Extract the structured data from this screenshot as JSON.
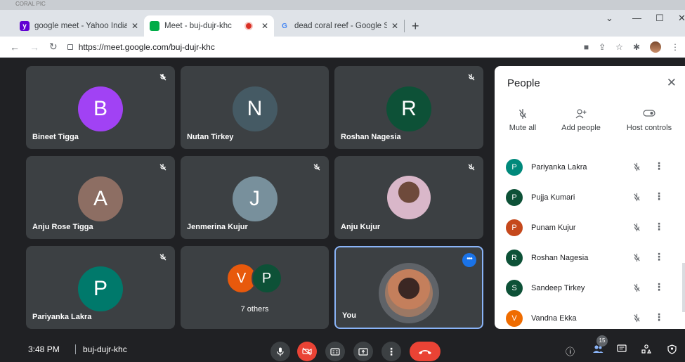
{
  "browser": {
    "top_label": "CORAL PIC",
    "tabs": [
      {
        "title": "google meet - Yahoo India Searc",
        "favicon": "yahoo-icon",
        "color": "#6001d2"
      },
      {
        "title": "Meet - buj-dujr-khc",
        "favicon": "meet-icon",
        "color": "#00ac47"
      },
      {
        "title": "dead coral reef - Google Search",
        "favicon": "google-icon",
        "color": "#4285f4"
      }
    ],
    "close_glyph": "✕",
    "new_tab": "+",
    "url": "https://meet.google.com/buj-dujr-khc"
  },
  "tiles": [
    {
      "name": "Bineet Tigga",
      "initial": "B",
      "color": "#a142f4"
    },
    {
      "name": "Nutan Tirkey",
      "initial": "N",
      "color": "#455a64"
    },
    {
      "name": "Roshan Nagesia",
      "initial": "R",
      "color": "#0d5137"
    },
    {
      "name": "Anju Rose Tigga",
      "initial": "A",
      "color": "#8d6e63"
    },
    {
      "name": "Jenmerina Kujur",
      "initial": "J",
      "color": "#78909c"
    },
    {
      "name": "Anju Kujur",
      "initial": "",
      "color": "#5f6368"
    },
    {
      "name": "Pariyanka Lakra",
      "initial": "P",
      "color": "#00796b"
    },
    {
      "name": "",
      "initial": "",
      "color": "#3c4043"
    },
    {
      "name": "You",
      "initial": "",
      "color": "#3c4043"
    }
  ],
  "others": {
    "label": "7 others",
    "avatars": [
      {
        "initial": "V",
        "color": "#e8590c"
      },
      {
        "initial": "P",
        "color": "#0d5137"
      }
    ]
  },
  "people_panel": {
    "title": "People",
    "actions": [
      {
        "label": "Mute all",
        "icon": "mic-off-icon"
      },
      {
        "label": "Add people",
        "icon": "add-person-icon"
      },
      {
        "label": "Host controls",
        "icon": "toggle-icon"
      }
    ],
    "participants": [
      {
        "name": "Pariyanka Lakra",
        "initial": "P",
        "color": "#00897b"
      },
      {
        "name": "Pujja Kumari",
        "initial": "P",
        "color": "#0d5137"
      },
      {
        "name": "Punam Kujur",
        "initial": "P",
        "color": "#c5481c"
      },
      {
        "name": "Roshan Nagesia",
        "initial": "R",
        "color": "#0d5137"
      },
      {
        "name": "Sandeep Tirkey",
        "initial": "S",
        "color": "#0d5137"
      },
      {
        "name": "Vandna Ekka",
        "initial": "V",
        "color": "#ef6c00"
      }
    ]
  },
  "bottom_bar": {
    "time": "3:48 PM",
    "meeting_code": "buj-dujr-khc",
    "people_count": "15"
  }
}
